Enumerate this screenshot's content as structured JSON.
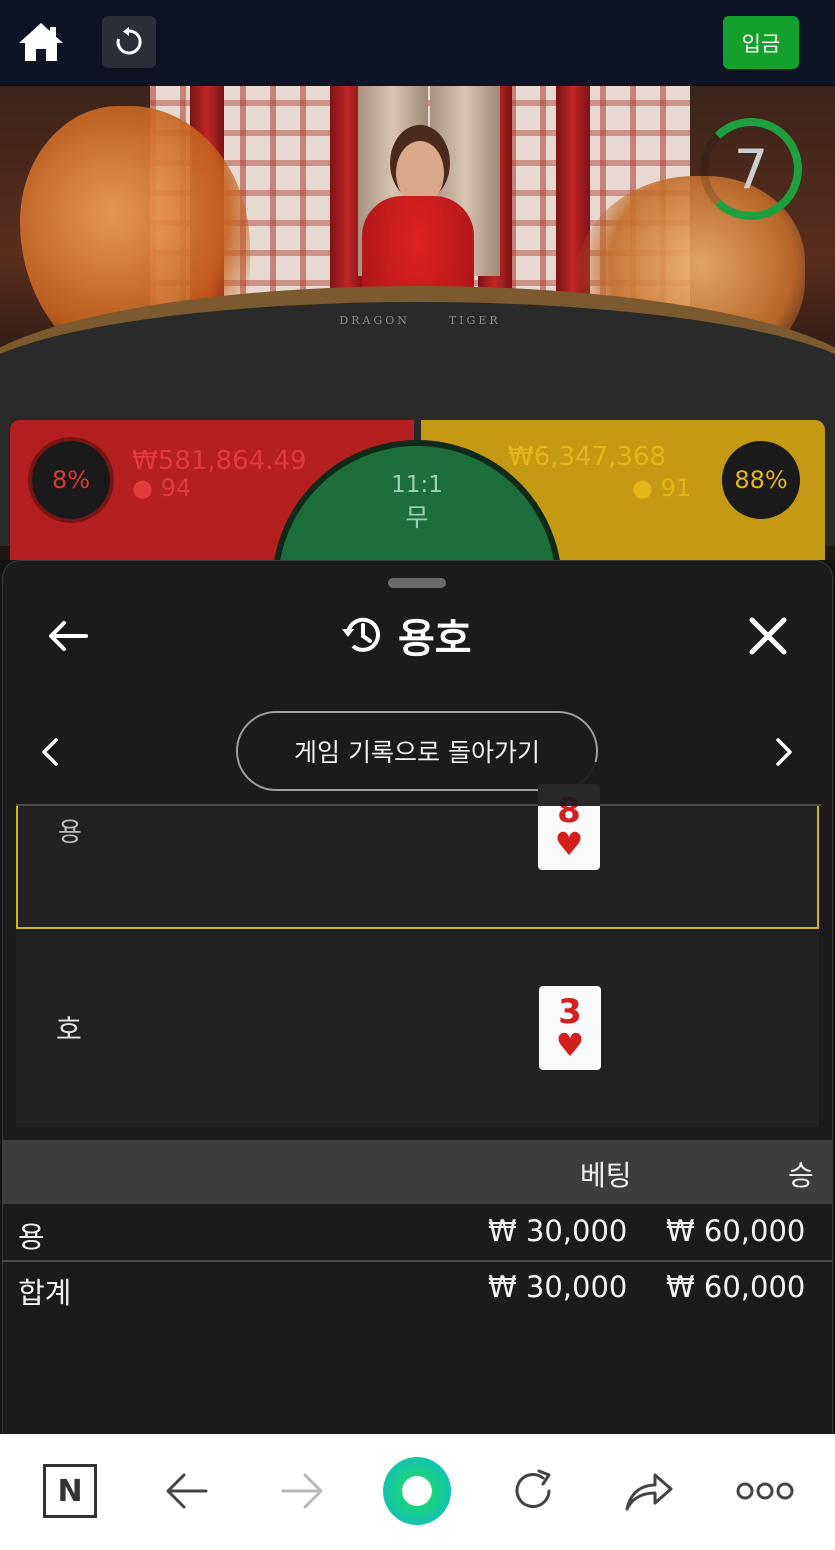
{
  "topbar": {
    "deposit_label": "입금",
    "icons": [
      "home-icon",
      "reload-icon"
    ]
  },
  "video": {
    "table_text_dragon": "DRAGON",
    "table_text_tiger": "TIGER",
    "countdown": "7"
  },
  "bets": {
    "dragon": {
      "percent": "8%",
      "amount": "₩581,864.49",
      "players": "94"
    },
    "tiger": {
      "percent": "88%",
      "amount": "₩6,347,368",
      "players": "91"
    },
    "tie": {
      "odds": "11:1",
      "label": "무"
    }
  },
  "sheet": {
    "title": "용호",
    "back_to_history": "게임 기록으로 돌아가기",
    "dragon_label": "용",
    "tiger_label": "호",
    "dragon_card": {
      "rank": "8",
      "suit": "♥"
    },
    "tiger_card": {
      "rank": "3",
      "suit": "♥"
    },
    "results": {
      "headers": {
        "bet": "베팅",
        "win": "승"
      },
      "rows": [
        {
          "label": "용",
          "bet": "₩ 30,000",
          "win": "₩ 60,000"
        },
        {
          "label": "합계",
          "bet": "₩ 30,000",
          "win": "₩ 60,000"
        }
      ]
    }
  },
  "toolbar": {
    "n_label": "N",
    "icons": [
      "n-icon",
      "back-arrow-icon",
      "forward-arrow-icon",
      "green-orb-icon",
      "refresh-icon",
      "share-icon",
      "more-icon"
    ]
  },
  "colors": {
    "dragon_red": "#b41f1f",
    "tiger_gold": "#c49a14",
    "tie_green": "#1c6e3a",
    "deposit_green": "#14a02c",
    "highlight_gold": "#d4b21a"
  }
}
